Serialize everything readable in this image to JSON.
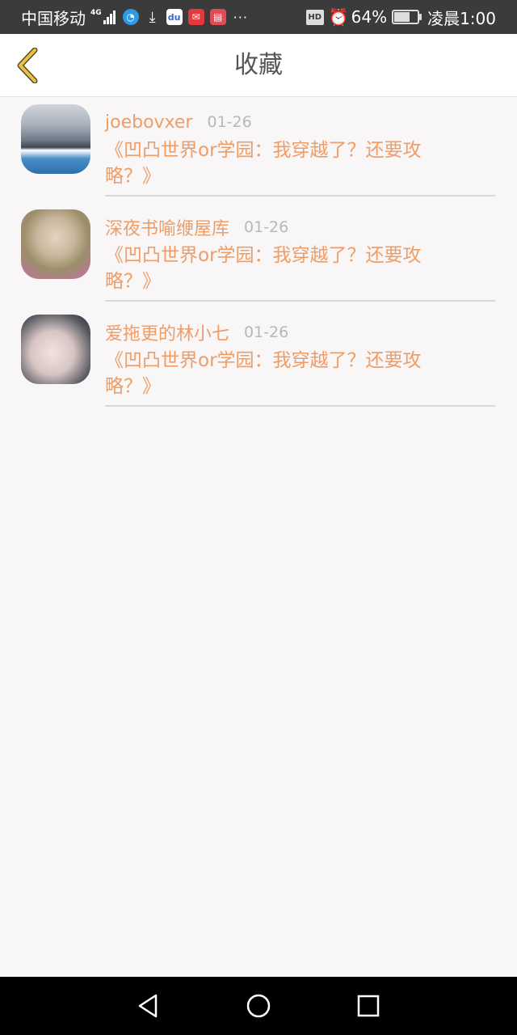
{
  "status_bar": {
    "carrier": "中国移动",
    "network": "4G",
    "more": "···",
    "hd": "HD",
    "battery": "64%",
    "time": "凌晨1:00",
    "icons": [
      "signal-icon",
      "browser-icon",
      "download-icon",
      "baidu-icon",
      "mail-icon",
      "reader-icon",
      "alarm-icon",
      "battery-icon"
    ]
  },
  "header": {
    "title": "收藏",
    "back_icon": "chevron-left-icon",
    "accent_color": "#e8b53a"
  },
  "favorites": [
    {
      "user": "joebovxer",
      "date": "01-26",
      "title": "《凹凸世界or学园：我穿越了？还要攻略？》"
    },
    {
      "user": "深夜书喻缏屋库",
      "date": "01-26",
      "title": "《凹凸世界or学园：我穿越了？还要攻略？》"
    },
    {
      "user": "爱拖更的林小七",
      "date": "01-26",
      "title": "《凹凸世界or学园：我穿越了？还要攻略？》"
    }
  ],
  "colors": {
    "text_accent": "#ee9d67",
    "date": "#b8b8b8",
    "background": "#f8f6f7"
  },
  "nav": {
    "icons": [
      "back-triangle-icon",
      "home-circle-icon",
      "recent-square-icon"
    ]
  }
}
